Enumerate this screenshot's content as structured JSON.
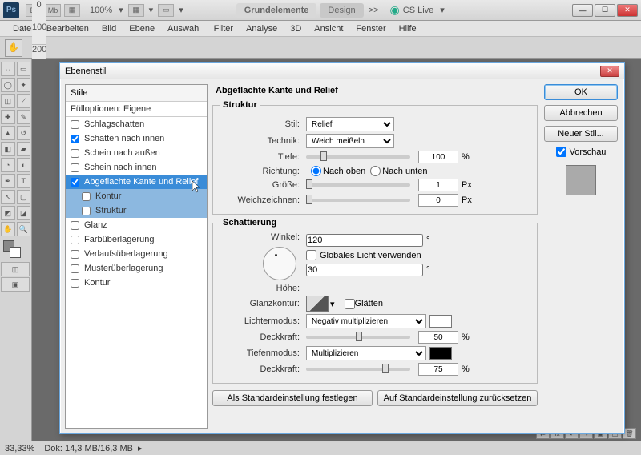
{
  "app": {
    "icon": "Ps",
    "zoom": "100%"
  },
  "titlebar": {
    "icons": [
      "Br",
      "Mb",
      "□"
    ],
    "tabs": [
      "Grundelemente",
      "Design"
    ],
    "more": ">>",
    "cslive": "CS Live"
  },
  "menu": [
    "Datei",
    "Bearbeiten",
    "Bild",
    "Ebene",
    "Auswahl",
    "Filter",
    "Analyse",
    "3D",
    "Ansicht",
    "Fenster",
    "Hilfe"
  ],
  "status": {
    "zoom": "33,33%",
    "doc": "Dok: 14,3 MB/16,3 MB"
  },
  "dialog": {
    "title": "Ebenenstil",
    "left": {
      "header": "Stile",
      "blend": "Fülloptionen: Eigene",
      "items": [
        {
          "label": "Schlagschatten",
          "checked": false
        },
        {
          "label": "Schatten nach innen",
          "checked": true
        },
        {
          "label": "Schein nach außen",
          "checked": false
        },
        {
          "label": "Schein nach innen",
          "checked": false
        },
        {
          "label": "Abgeflachte Kante und Relief",
          "checked": true,
          "selected": true
        },
        {
          "label": "Kontur",
          "checked": false,
          "sub": true
        },
        {
          "label": "Struktur",
          "checked": false,
          "sub": true
        },
        {
          "label": "Glanz",
          "checked": false
        },
        {
          "label": "Farbüberlagerung",
          "checked": false
        },
        {
          "label": "Verlaufsüberlagerung",
          "checked": false
        },
        {
          "label": "Musterüberlagerung",
          "checked": false
        },
        {
          "label": "Kontur",
          "checked": false
        }
      ]
    },
    "mid": {
      "title": "Abgeflachte Kante und Relief",
      "struktur": {
        "legend": "Struktur",
        "stil_label": "Stil:",
        "stil_value": "Relief",
        "technik_label": "Technik:",
        "technik_value": "Weich meißeln",
        "tiefe_label": "Tiefe:",
        "tiefe_value": "100",
        "tiefe_unit": "%",
        "richtung_label": "Richtung:",
        "richtung_up": "Nach oben",
        "richtung_down": "Nach unten",
        "groesse_label": "Größe:",
        "groesse_value": "1",
        "groesse_unit": "Px",
        "weich_label": "Weichzeichnen:",
        "weich_value": "0",
        "weich_unit": "Px"
      },
      "schatt": {
        "legend": "Schattierung",
        "winkel_label": "Winkel:",
        "winkel_value": "120",
        "winkel_unit": "°",
        "global_label": "Globales Licht verwenden",
        "hoehe_label": "Höhe:",
        "hoehe_value": "30",
        "hoehe_unit": "°",
        "glanz_label": "Glanzkontur:",
        "glaetten_label": "Glätten",
        "licht_label": "Lichtermodus:",
        "licht_value": "Negativ multiplizieren",
        "licht_color": "#ffffff",
        "deck1_label": "Deckkraft:",
        "deck1_value": "50",
        "deck_unit": "%",
        "tiefen_label": "Tiefenmodus:",
        "tiefen_value": "Multiplizieren",
        "tiefen_color": "#000000",
        "deck2_label": "Deckkraft:",
        "deck2_value": "75"
      },
      "btm": {
        "default": "Als Standardeinstellung festlegen",
        "reset": "Auf Standardeinstellung zurücksetzen"
      }
    },
    "right": {
      "ok": "OK",
      "cancel": "Abbrechen",
      "newstyle": "Neuer Stil...",
      "preview": "Vorschau"
    }
  }
}
